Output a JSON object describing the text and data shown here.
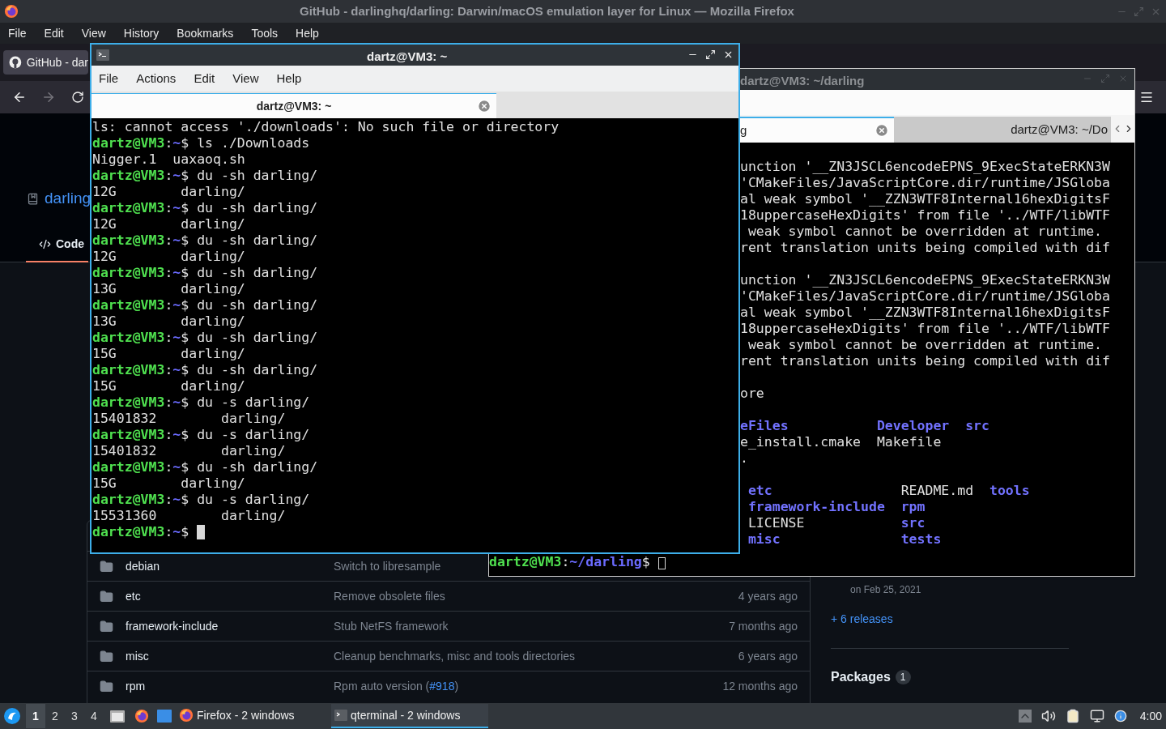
{
  "browser": {
    "title": "GitHub - darlinghq/darling: Darwin/macOS emulation layer for Linux — Mozilla Firefox",
    "menu": [
      "File",
      "Edit",
      "View",
      "History",
      "Bookmarks",
      "Tools",
      "Help"
    ],
    "tab": {
      "label": "GitHub - dar",
      "selected": true
    },
    "page": {
      "repo_link": "darling",
      "code_tab": {
        "label": "Code",
        "selected": true
      },
      "files": [
        {
          "name": "debian",
          "message": "Switch to libresample"
        },
        {
          "name": "etc",
          "message": "Remove obsolete files",
          "time": "4 years ago"
        },
        {
          "name": "framework-include",
          "message": "Stub NetFS framework",
          "time": "7 months ago"
        },
        {
          "name": "misc",
          "message": "Cleanup benchmarks, misc and tools directories",
          "time": "6 years ago"
        },
        {
          "name": "rpm",
          "message": "Rpm auto version (",
          "link": "#918",
          "suffix": ")",
          "time": "12 months ago"
        }
      ],
      "sidebar": {
        "release_date": "on Feb 25, 2021",
        "releases_link": "+ 6 releases",
        "packages_label": "Packages",
        "packages_count": "1"
      }
    }
  },
  "back_terminal": {
    "title": "dartz@VM3: ~/darling",
    "cursor_focused": false,
    "tabs": [
      {
        "label": "g",
        "selected": true
      },
      {
        "label": "dartz@VM3: ~/Do",
        "selected": false
      }
    ],
    "blocks": [
      [
        [
          {
            "text": "unction '__ZN3JSCL6encodeEPNS_9ExecStateERKN3W",
            "kind": "plain"
          }
        ],
        [
          {
            "text": "'CMakeFiles/JavaScriptCore.dir/runtime/JSGloba",
            "kind": "plain"
          }
        ],
        [
          {
            "text": "al weak symbol '__ZZN3WTF8Internal16hexDigitsF",
            "kind": "plain"
          }
        ],
        [
          {
            "text": "18uppercaseHexDigits' from file '../WTF/libWTF",
            "kind": "plain"
          }
        ],
        [
          {
            "text": " weak symbol cannot be overridden at runtime.",
            "kind": "plain"
          }
        ],
        [
          {
            "text": "rent translation units being compiled with dif",
            "kind": "plain"
          }
        ]
      ],
      [
        [
          {
            "text": "unction '__ZN3JSCL6encodeEPNS_9ExecStateERKN3W",
            "kind": "plain"
          }
        ],
        [
          {
            "text": "'CMakeFiles/JavaScriptCore.dir/runtime/JSGloba",
            "kind": "plain"
          }
        ],
        [
          {
            "text": "al weak symbol '__ZZN3WTF8Internal16hexDigitsF",
            "kind": "plain"
          }
        ],
        [
          {
            "text": "18uppercaseHexDigits' from file '../WTF/libWTF",
            "kind": "plain"
          }
        ],
        [
          {
            "text": " weak symbol cannot be overridden at runtime.",
            "kind": "plain"
          }
        ],
        [
          {
            "text": "rent translation units being compiled with dif",
            "kind": "plain"
          }
        ]
      ],
      [
        [
          {
            "text": "ore",
            "kind": "plain"
          }
        ]
      ],
      [
        [
          {
            "text": "eFiles           ",
            "kind": "dir"
          },
          {
            "text": "Developer  ",
            "kind": "dir"
          },
          {
            "text": "src",
            "kind": "dir"
          }
        ],
        [
          {
            "text": "e_install.cmake  ",
            "kind": "plain"
          },
          {
            "text": "Makefile",
            "kind": "plain"
          }
        ],
        [
          {
            "text": ".",
            "kind": "plain"
          }
        ]
      ],
      [
        [
          {
            "text": " etc                ",
            "kind": "dir"
          },
          {
            "text": "README.md  ",
            "kind": "plain"
          },
          {
            "text": "tools",
            "kind": "dir"
          }
        ],
        [
          {
            "text": " framework-include  ",
            "kind": "dir"
          },
          {
            "text": "rpm",
            "kind": "dir"
          }
        ],
        [
          {
            "text": " LICENSE            ",
            "kind": "plain"
          },
          {
            "text": "src",
            "kind": "dir"
          }
        ],
        [
          {
            "text": " misc               ",
            "kind": "dir"
          },
          {
            "text": "tests",
            "kind": "dir"
          }
        ]
      ]
    ],
    "prompt": [
      {
        "text": "dartz@VM3",
        "kind": "user"
      },
      {
        "text": ":",
        "kind": "plain"
      },
      {
        "text": "~/darling",
        "kind": "path"
      },
      {
        "text": "$ ",
        "kind": "plain"
      }
    ]
  },
  "front_terminal": {
    "title": "dartz@VM3: ~",
    "menu": [
      "File",
      "Actions",
      "Edit",
      "View",
      "Help"
    ],
    "cursor_focused": true,
    "tabs": [
      {
        "label": "dartz@VM3: ~",
        "selected": true
      }
    ],
    "lines": [
      [
        {
          "text": "ls: cannot access './downloads': No such file or directory",
          "kind": "plain"
        }
      ],
      [
        {
          "text": "dartz@VM3",
          "kind": "user"
        },
        {
          "text": ":",
          "kind": "plain"
        },
        {
          "text": "~",
          "kind": "path"
        },
        {
          "text": "$ ls ./Downloads",
          "kind": "plain"
        }
      ],
      [
        {
          "text": "Nigger.1  uaxaoq.sh",
          "kind": "plain"
        }
      ],
      [
        {
          "text": "dartz@VM3",
          "kind": "user"
        },
        {
          "text": ":",
          "kind": "plain"
        },
        {
          "text": "~",
          "kind": "path"
        },
        {
          "text": "$ du -sh darling/",
          "kind": "plain"
        }
      ],
      [
        {
          "text": "12G        darling/",
          "kind": "plain"
        }
      ],
      [
        {
          "text": "dartz@VM3",
          "kind": "user"
        },
        {
          "text": ":",
          "kind": "plain"
        },
        {
          "text": "~",
          "kind": "path"
        },
        {
          "text": "$ du -sh darling/",
          "kind": "plain"
        }
      ],
      [
        {
          "text": "12G        darling/",
          "kind": "plain"
        }
      ],
      [
        {
          "text": "dartz@VM3",
          "kind": "user"
        },
        {
          "text": ":",
          "kind": "plain"
        },
        {
          "text": "~",
          "kind": "path"
        },
        {
          "text": "$ du -sh darling/",
          "kind": "plain"
        }
      ],
      [
        {
          "text": "12G        darling/",
          "kind": "plain"
        }
      ],
      [
        {
          "text": "dartz@VM3",
          "kind": "user"
        },
        {
          "text": ":",
          "kind": "plain"
        },
        {
          "text": "~",
          "kind": "path"
        },
        {
          "text": "$ du -sh darling/",
          "kind": "plain"
        }
      ],
      [
        {
          "text": "13G        darling/",
          "kind": "plain"
        }
      ],
      [
        {
          "text": "dartz@VM3",
          "kind": "user"
        },
        {
          "text": ":",
          "kind": "plain"
        },
        {
          "text": "~",
          "kind": "path"
        },
        {
          "text": "$ du -sh darling/",
          "kind": "plain"
        }
      ],
      [
        {
          "text": "13G        darling/",
          "kind": "plain"
        }
      ],
      [
        {
          "text": "dartz@VM3",
          "kind": "user"
        },
        {
          "text": ":",
          "kind": "plain"
        },
        {
          "text": "~",
          "kind": "path"
        },
        {
          "text": "$ du -sh darling/",
          "kind": "plain"
        }
      ],
      [
        {
          "text": "15G        darling/",
          "kind": "plain"
        }
      ],
      [
        {
          "text": "dartz@VM3",
          "kind": "user"
        },
        {
          "text": ":",
          "kind": "plain"
        },
        {
          "text": "~",
          "kind": "path"
        },
        {
          "text": "$ du -sh darling/",
          "kind": "plain"
        }
      ],
      [
        {
          "text": "15G        darling/",
          "kind": "plain"
        }
      ],
      [
        {
          "text": "dartz@VM3",
          "kind": "user"
        },
        {
          "text": ":",
          "kind": "plain"
        },
        {
          "text": "~",
          "kind": "path"
        },
        {
          "text": "$ du -s darling/",
          "kind": "plain"
        }
      ],
      [
        {
          "text": "15401832        darling/",
          "kind": "plain"
        }
      ],
      [
        {
          "text": "dartz@VM3",
          "kind": "user"
        },
        {
          "text": ":",
          "kind": "plain"
        },
        {
          "text": "~",
          "kind": "path"
        },
        {
          "text": "$ du -s darling/",
          "kind": "plain"
        }
      ],
      [
        {
          "text": "15401832        darling/",
          "kind": "plain"
        }
      ],
      [
        {
          "text": "dartz@VM3",
          "kind": "user"
        },
        {
          "text": ":",
          "kind": "plain"
        },
        {
          "text": "~",
          "kind": "path"
        },
        {
          "text": "$ du -sh darling/",
          "kind": "plain"
        }
      ],
      [
        {
          "text": "15G        darling/",
          "kind": "plain"
        }
      ],
      [
        {
          "text": "dartz@VM3",
          "kind": "user"
        },
        {
          "text": ":",
          "kind": "plain"
        },
        {
          "text": "~",
          "kind": "path"
        },
        {
          "text": "$ du -s darling/",
          "kind": "plain"
        }
      ],
      [
        {
          "text": "15531360        darling/",
          "kind": "plain"
        }
      ]
    ],
    "prompt": [
      {
        "text": "dartz@VM3",
        "kind": "user"
      },
      {
        "text": ":",
        "kind": "plain"
      },
      {
        "text": "~",
        "kind": "path"
      },
      {
        "text": "$ ",
        "kind": "plain"
      }
    ]
  },
  "taskbar": {
    "desktops": [
      {
        "label": "1",
        "selected": true
      },
      {
        "label": "2",
        "selected": false
      },
      {
        "label": "3",
        "selected": false
      },
      {
        "label": "4",
        "selected": false
      }
    ],
    "tasks": [
      {
        "label": "Firefox - 2 windows",
        "kind": "firefox",
        "selected": false
      },
      {
        "label": "qterminal - 2 windows",
        "kind": "terminal",
        "selected": true
      }
    ],
    "clock": "4:00"
  }
}
